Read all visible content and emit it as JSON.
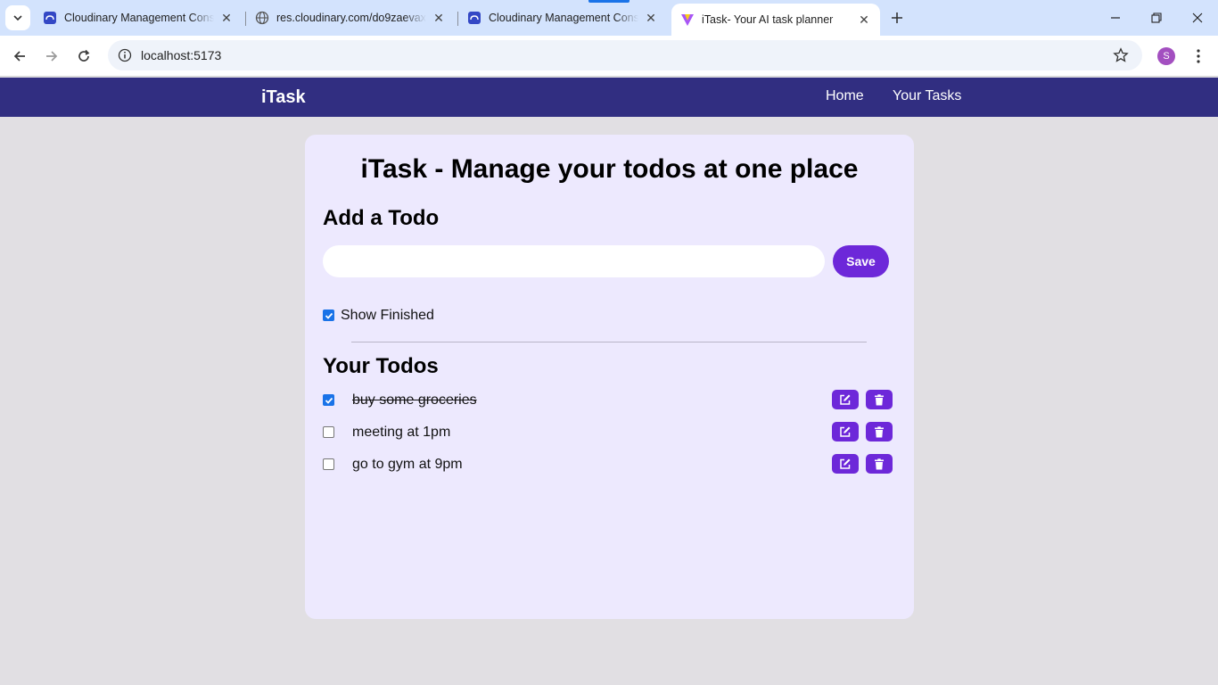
{
  "browser": {
    "tabs": [
      {
        "title": "Cloudinary Management Console",
        "favicon": "cloudinary-icon",
        "active": false
      },
      {
        "title": "res.cloudinary.com/do9zaevax/image",
        "favicon": "globe-icon",
        "active": false
      },
      {
        "title": "Cloudinary Management Console",
        "favicon": "cloudinary-icon",
        "active": false
      },
      {
        "title": "iTask- Your AI task planner",
        "favicon": "vite-icon",
        "active": true
      }
    ],
    "url": "localhost:5173",
    "profile_initial": "S"
  },
  "app": {
    "brand": "iTask",
    "nav": {
      "home": "Home",
      "your_tasks": "Your Tasks"
    },
    "heading": "iTask - Manage your todos at one place",
    "add_heading": "Add a Todo",
    "input": {
      "value": "",
      "placeholder": ""
    },
    "save_label": "Save",
    "show_finished": {
      "label": "Show Finished",
      "checked": true
    },
    "todos_heading": "Your Todos",
    "todos": [
      {
        "text": "buy some groceries",
        "done": true
      },
      {
        "text": "meeting at 1pm",
        "done": false
      },
      {
        "text": "go to gym at 9pm",
        "done": false
      }
    ]
  },
  "colors": {
    "navbar": "#312e81",
    "card": "#ede9fe",
    "accent": "#6d28d9",
    "page_bg": "#e1dfe3"
  }
}
